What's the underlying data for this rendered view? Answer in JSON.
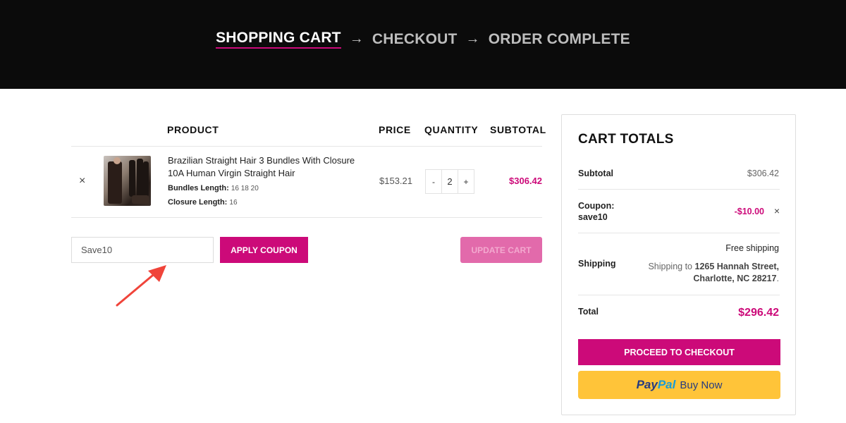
{
  "header": {
    "steps": [
      "SHOPPING CART",
      "CHECKOUT",
      "ORDER COMPLETE"
    ],
    "arrow": "→"
  },
  "cart": {
    "columns": {
      "product": "PRODUCT",
      "price": "PRICE",
      "quantity": "QUANTITY",
      "subtotal": "SUBTOTAL"
    },
    "item": {
      "remove": "×",
      "name": "Brazilian Straight Hair 3 Bundles With Closure 10A Human Virgin Straight Hair",
      "bundles_label": "Bundles Length:",
      "bundles_value": "16 18 20",
      "closure_label": "Closure Length:",
      "closure_value": "16",
      "price": "$153.21",
      "qty_minus": "-",
      "qty": "2",
      "qty_plus": "+",
      "subtotal": "$306.42"
    },
    "coupon_value": "Save10",
    "apply_label": "APPLY COUPON",
    "update_label": "UPDATE CART"
  },
  "totals": {
    "title": "CART TOTALS",
    "subtotal_label": "Subtotal",
    "subtotal_value": "$306.42",
    "coupon_label": "Coupon:",
    "coupon_code": "save10",
    "coupon_amount": "-$10.00",
    "coupon_remove": "×",
    "shipping_label": "Shipping",
    "shipping_method": "Free shipping",
    "shipping_to_prefix": "Shipping to",
    "shipping_address": "1265 Hannah Street, Charlotte, NC 28217",
    "total_label": "Total",
    "total_value": "$296.42",
    "checkout_label": "PROCEED TO CHECKOUT",
    "paypal_part1": "Pay",
    "paypal_part2": "Pal",
    "paypal_text": "Buy Now"
  },
  "colors": {
    "accent": "#cc0a79",
    "header_bg": "#0b0b0b",
    "paypal": "#ffc439",
    "annotation": "#f0443a"
  }
}
